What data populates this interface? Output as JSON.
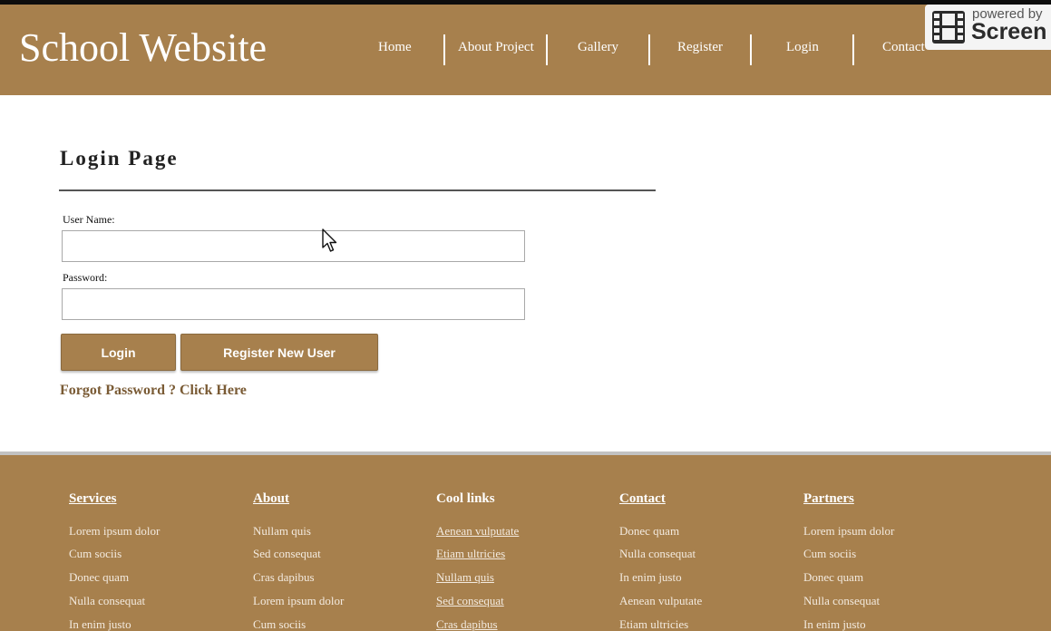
{
  "header": {
    "site_title": "School Website",
    "nav": [
      {
        "label": "Home"
      },
      {
        "label": "About Project"
      },
      {
        "label": "Gallery"
      },
      {
        "label": "Register"
      },
      {
        "label": "Login"
      },
      {
        "label": "Contact"
      }
    ]
  },
  "watermark": {
    "powered": "powered by",
    "brand": "Screen"
  },
  "login": {
    "title": "Login Page",
    "username_label": "User Name:",
    "username_value": "",
    "password_label": "Password:",
    "password_value": "",
    "login_button": "Login",
    "register_button": "Register New User",
    "forgot_link": "Forgot Password ? Click Here"
  },
  "footer": {
    "columns": [
      {
        "heading": "Services",
        "items": [
          "Lorem ipsum dolor",
          "Cum sociis",
          "Donec quam",
          "Nulla consequat",
          "In enim justo"
        ]
      },
      {
        "heading": "About",
        "items": [
          "Nullam quis",
          "Sed consequat",
          "Cras dapibus",
          "Lorem ipsum dolor",
          "Cum sociis"
        ]
      },
      {
        "heading": "Cool links",
        "items": [
          "Aenean vulputate",
          "Etiam ultricies",
          "Nullam quis",
          "Sed consequat",
          "Cras dapibus"
        ]
      },
      {
        "heading": "Contact",
        "items": [
          "Donec quam",
          "Nulla consequat",
          "In enim justo",
          "Aenean vulputate",
          "Etiam ultricies"
        ]
      },
      {
        "heading": "Partners",
        "items": [
          "Lorem ipsum dolor",
          "Cum sociis",
          "Donec quam",
          "Nulla consequat",
          "In enim justo"
        ]
      }
    ]
  },
  "colors": {
    "brand": "#a7804d",
    "link": "#7a5b35"
  }
}
